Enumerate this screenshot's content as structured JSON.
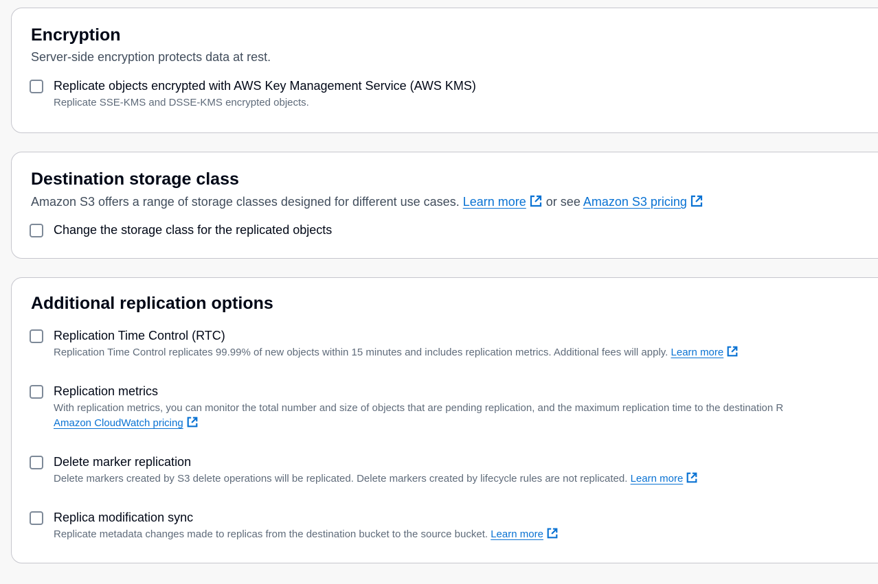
{
  "encryption": {
    "title": "Encryption",
    "description": "Server-side encryption protects data at rest.",
    "option_label": "Replicate objects encrypted with AWS Key Management Service (AWS KMS)",
    "option_description": "Replicate SSE-KMS and DSSE-KMS encrypted objects.",
    "option_checked": false
  },
  "storage_class": {
    "title": "Destination storage class",
    "description_prefix": "Amazon S3 offers a range of storage classes designed for different use cases.",
    "learn_more_link": "Learn more",
    "description_middle": "or see",
    "pricing_link": "Amazon S3 pricing",
    "option_label": "Change the storage class for the replicated objects",
    "option_checked": false
  },
  "additional": {
    "title": "Additional replication options",
    "rtc": {
      "label": "Replication Time Control (RTC)",
      "description": "Replication Time Control replicates 99.99% of new objects within 15 minutes and includes replication metrics. Additional fees will apply.",
      "link": "Learn more",
      "checked": false
    },
    "metrics": {
      "label": "Replication metrics",
      "description": "With replication metrics, you can monitor the total number and size of objects that are pending replication, and the maximum replication time to the destination R",
      "link": "Amazon CloudWatch pricing",
      "checked": false
    },
    "delete_marker": {
      "label": "Delete marker replication",
      "description": "Delete markers created by S3 delete operations will be replicated. Delete markers created by lifecycle rules are not replicated.",
      "link": "Learn more",
      "checked": false
    },
    "replica_sync": {
      "label": "Replica modification sync",
      "description": "Replicate metadata changes made to replicas from the destination bucket to the source bucket.",
      "link": "Learn more",
      "checked": false
    }
  },
  "icons": {
    "external_link": "external-link-icon"
  },
  "colors": {
    "link": "#0972d3",
    "border": "#c6c6cd",
    "checkbox_border": "#7d8998"
  }
}
